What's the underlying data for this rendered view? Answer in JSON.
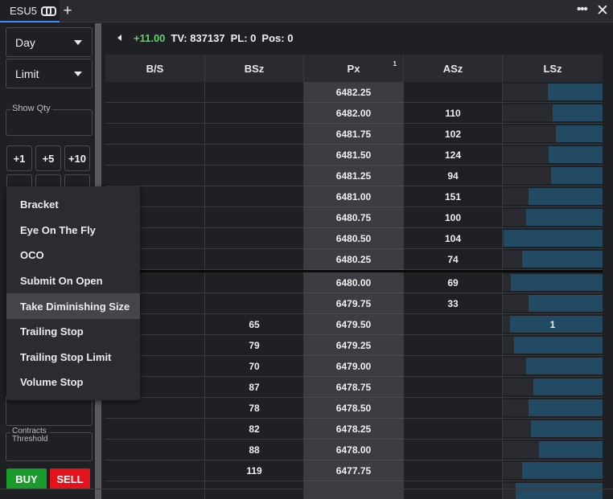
{
  "tab": {
    "label": "ESU5",
    "new_tab": "+"
  },
  "window": {
    "more": "•••",
    "close": "✕"
  },
  "left": {
    "tif": "Day",
    "order_type": "Limit",
    "show_qty_label": "Show Qty",
    "qty_buttons": [
      "+1",
      "+5",
      "+10"
    ],
    "contracts_threshold_label": "Contracts\nThreshold",
    "buy_label": "BUY",
    "sell_label": "SELL"
  },
  "menu": {
    "items": [
      "Bracket",
      "Eye On The Fly",
      "OCO",
      "Submit On Open",
      "Take Diminishing Size",
      "Trailing Stop",
      "Trailing Stop Limit",
      "Volume Stop"
    ],
    "highlighted_index": 4
  },
  "status": {
    "change": "+11.00",
    "tv": "TV: 837137",
    "pl": "PL: 0",
    "pos": "Pos: 0"
  },
  "ladder": {
    "headers": [
      "B/S",
      "BSz",
      "Px",
      "ASz",
      "LSz"
    ],
    "px_sup": "1",
    "rows": [
      {
        "bs": "",
        "bsz": "",
        "px": "6482.25",
        "asz": "",
        "lsz": "",
        "lsz_fill": 0.55
      },
      {
        "bs": "",
        "bsz": "",
        "px": "6482.00",
        "asz": "110",
        "lsz": "",
        "lsz_fill": 0.5
      },
      {
        "bs": "",
        "bsz": "",
        "px": "6481.75",
        "asz": "102",
        "lsz": "",
        "lsz_fill": 0.47
      },
      {
        "bs": "",
        "bsz": "",
        "px": "6481.50",
        "asz": "124",
        "lsz": "",
        "lsz_fill": 0.54
      },
      {
        "bs": "",
        "bsz": "",
        "px": "6481.25",
        "asz": "94",
        "lsz": "",
        "lsz_fill": 0.52
      },
      {
        "bs": "",
        "bsz": "",
        "px": "6481.00",
        "asz": "151",
        "lsz": "",
        "lsz_fill": 0.74
      },
      {
        "bs": "",
        "bsz": "",
        "px": "6480.75",
        "asz": "100",
        "lsz": "",
        "lsz_fill": 0.77
      },
      {
        "bs": "",
        "bsz": "",
        "px": "6480.50",
        "asz": "104",
        "lsz": "",
        "lsz_fill": 0.99
      },
      {
        "bs": "",
        "bsz": "",
        "px": "6480.25",
        "asz": "74",
        "lsz": "",
        "lsz_fill": 0.81
      },
      {
        "bs": "",
        "bsz": "",
        "px": "6480.00",
        "asz": "69",
        "lsz": "",
        "lsz_fill": 0.92
      },
      {
        "bs": "",
        "bsz": "",
        "px": "6479.75",
        "asz": "33",
        "lsz": "",
        "lsz_fill": 0.74
      },
      {
        "bs": "",
        "bsz": "65",
        "px": "6479.50",
        "asz": "",
        "lsz": "1",
        "lsz_fill": 0.93
      },
      {
        "bs": "",
        "bsz": "79",
        "px": "6479.25",
        "asz": "",
        "lsz": "",
        "lsz_fill": 0.89
      },
      {
        "bs": "",
        "bsz": "70",
        "px": "6479.00",
        "asz": "",
        "lsz": "",
        "lsz_fill": 0.77
      },
      {
        "bs": "",
        "bsz": "87",
        "px": "6478.75",
        "asz": "",
        "lsz": "",
        "lsz_fill": 0.69
      },
      {
        "bs": "",
        "bsz": "78",
        "px": "6478.50",
        "asz": "",
        "lsz": "",
        "lsz_fill": 0.74
      },
      {
        "bs": "",
        "bsz": "82",
        "px": "6478.25",
        "asz": "",
        "lsz": "",
        "lsz_fill": 0.72
      },
      {
        "bs": "",
        "bsz": "88",
        "px": "6478.00",
        "asz": "",
        "lsz": "",
        "lsz_fill": 0.64
      },
      {
        "bs": "",
        "bsz": "119",
        "px": "6477.75",
        "asz": "",
        "lsz": "",
        "lsz_fill": 0.81
      },
      {
        "bs": "",
        "bsz": "",
        "px": "",
        "asz": "",
        "lsz": "",
        "lsz_fill": 0.87
      }
    ],
    "last_trade_after_index": 8
  },
  "colors": {
    "accent": "#3d8bff",
    "buy": "#1a9c2c",
    "sell": "#e3121b",
    "change_up": "#5fd36a",
    "lsz_fill": "#234a63"
  }
}
